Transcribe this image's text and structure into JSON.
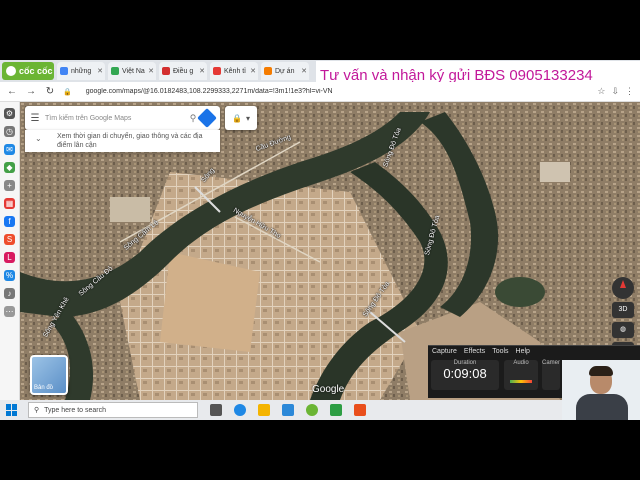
{
  "banner": {
    "text": "Tư vấn và nhận ký gửi BĐS 0905133234"
  },
  "browser": {
    "name": "cốc cốc",
    "tabs": [
      {
        "label": "những",
        "icon": "google-icon",
        "color": "#4285f4"
      },
      {
        "label": "Việt Na",
        "icon": "globe-icon",
        "color": "#34a853"
      },
      {
        "label": "Điều g",
        "icon": "v-icon",
        "color": "#d32f2f"
      },
      {
        "label": "Kênh tỉ",
        "icon": "p-icon",
        "color": "#e53935"
      },
      {
        "label": "Dự án",
        "icon": "s-icon",
        "color": "#f57c00"
      }
    ],
    "url": "google.com/maps/@16.0182483,108.2299333,2271m/data=!3m1!1e3?hl=vi-VN"
  },
  "map": {
    "search_placeholder": "Tìm kiếm trên Google Maps",
    "travel_hint": "Xem thời gian di chuyển, giao thông và các địa điểm lân cận",
    "layer_label": "Bản đồ",
    "logo": "Google",
    "ctrl_3d": "3D",
    "labels": {
      "cau_duong": "Cầu Đường",
      "do_toa_1": "Sông Đô Tỏa",
      "do_toa_2": "Sông Đô Tỏa",
      "do_toa_3": "Sông Đô Tỏa",
      "cam_le": "Sông Cẩm Lệ",
      "cau_do": "Sông Cầu Đỏ",
      "yen_khe": "Sông Yên Khê",
      "nguyen_huu_tho": "Nguyễn Hữu Thọ",
      "river_small": "Sông"
    }
  },
  "recorder": {
    "menu": [
      "Capture",
      "Effects",
      "Tools",
      "Help"
    ],
    "duration_label": "Duration",
    "duration": "0:09:08",
    "audio_label": "Audio",
    "camera_label": "Camer"
  },
  "taskbar": {
    "search_placeholder": "Type here to search",
    "apps": [
      {
        "name": "task-view",
        "color": "#555555"
      },
      {
        "name": "edge",
        "color": "#1e88e5"
      },
      {
        "name": "file-explorer",
        "color": "#f4b400"
      },
      {
        "name": "mail",
        "color": "#2b88d8"
      },
      {
        "name": "coccoc",
        "color": "#6bb534"
      },
      {
        "name": "camtasia-green",
        "color": "#2e9e44"
      },
      {
        "name": "camtasia",
        "color": "#e94e1b"
      }
    ]
  }
}
